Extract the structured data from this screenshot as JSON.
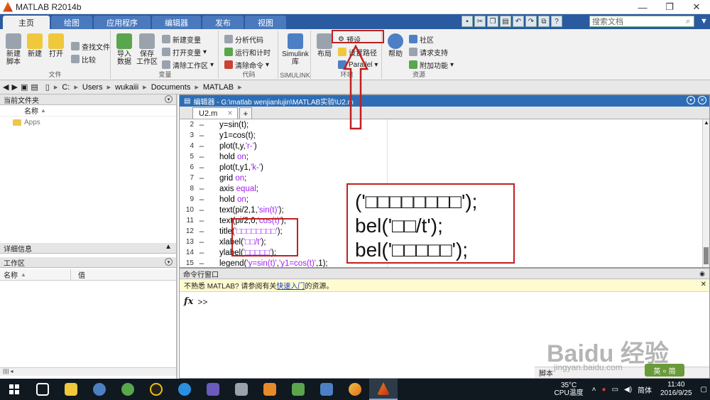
{
  "window": {
    "title": "MATLAB R2014b",
    "minimize": "—",
    "maximize": "❐",
    "close": "✕"
  },
  "ribbon_tabs": [
    "主页",
    "绘图",
    "应用程序",
    "编辑器",
    "发布",
    "视图"
  ],
  "search_docs_placeholder": "搜索文档",
  "ribbon": {
    "file": {
      "new_script": "新建\n脚本",
      "new": "新建",
      "open": "打开",
      "find_files": "查找文件",
      "compare": "比较",
      "group": "文件"
    },
    "variable": {
      "import": "导入\n数据",
      "save": "保存\n工作区",
      "new_var": "新建变量",
      "open_var": "打开变量",
      "clear_ws": "清除工作区",
      "group": "变量"
    },
    "code": {
      "analyze": "分析代码",
      "run_time": "运行和计时",
      "clear_cmds": "清除命令",
      "group": "代码"
    },
    "simulink": {
      "lib": "Simulink\n库",
      "group": "SIMULINK"
    },
    "env": {
      "layout": "布局",
      "prefs": "预设",
      "set_path": "设置路径",
      "parallel": "Parallel",
      "group": "环境"
    },
    "resources": {
      "help": "帮助",
      "community": "社区",
      "support": "请求支持",
      "addons": "附加功能",
      "group": "资源"
    }
  },
  "address": {
    "segments": [
      "C:",
      "Users",
      "wukaiii",
      "Documents",
      "MATLAB"
    ]
  },
  "current_folder": {
    "title": "当前文件夹",
    "column_name": "名称",
    "sort_indicator": "▲",
    "items": [
      "Apps"
    ]
  },
  "details": {
    "title": "详细信息"
  },
  "workspace": {
    "title": "工作区",
    "col_name": "名称",
    "col_value": "值",
    "sort_indicator": "▲"
  },
  "editor": {
    "title": "编辑器 - G:\\matlab wenjianlujin\\MATLAB实验\\U2.m",
    "tab": "U2.m",
    "add_tab": "+",
    "lines": [
      {
        "n": "2",
        "code": "y=sin(t);"
      },
      {
        "n": "3",
        "code": "y1=cos(t);"
      },
      {
        "n": "4",
        "code": "plot(t,y,'r-')"
      },
      {
        "n": "5",
        "code": "hold on;"
      },
      {
        "n": "6",
        "code": "plot(t,y1,'k-')"
      },
      {
        "n": "7",
        "code": "grid on;"
      },
      {
        "n": "8",
        "code": "axis equal;"
      },
      {
        "n": "9",
        "code": "hold on;"
      },
      {
        "n": "10",
        "code": "text(pi/2,1,'sin(t)');"
      },
      {
        "n": "11",
        "code": "text(pi/2,0,'cos(t)');"
      },
      {
        "n": "12",
        "code": "title('□□□□□□□□');"
      },
      {
        "n": "13",
        "code": "xlabel('□□/t');"
      },
      {
        "n": "14",
        "code": "ylabel('□□□□□');"
      },
      {
        "n": "15",
        "code": "legend('y=sin(t)','y1=cos(t)',1);"
      }
    ]
  },
  "zoom_panel": {
    "line1": "('□□□□□□□□');",
    "line2": "bel('□□/t');",
    "line3": "bel('□□□□□');"
  },
  "command_window": {
    "title": "命令行窗口",
    "notice_prefix": "不熟悉 MATLAB? 请参阅有关",
    "notice_link": "快速入门",
    "notice_suffix": "的资源。",
    "prompt": ">>",
    "fx": "fx",
    "status": "脚本"
  },
  "taskbar": {
    "temp": "35°C",
    "temp_label": "CPU温度",
    "ime": "简体",
    "time": "11:40",
    "date": "2016/9/25",
    "ime_overlay": "英 ⸰ 简"
  },
  "watermark": {
    "brand": "Baidu 经验",
    "url": "jingyan.baidu.com"
  }
}
